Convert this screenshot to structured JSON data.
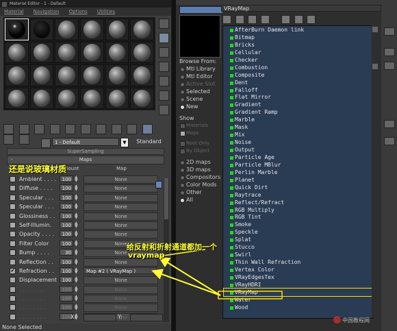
{
  "material_editor": {
    "title": "Material Editor - 1 - Default",
    "menu": [
      "Material",
      "Navigation",
      "Options",
      "Utilities"
    ],
    "material_name": "1 - Default",
    "material_type": "Standard",
    "rollout_supersampling": "SuperSampling",
    "rollout_maps_sign": "-",
    "rollout_maps": "Maps",
    "header_amount": "Amount",
    "header_map": "Map",
    "map_rows": [
      {
        "label": "Ambient . . . .",
        "amount": "100",
        "map": "None",
        "checked": false
      },
      {
        "label": "Diffuse . . . .",
        "amount": "100",
        "map": "None",
        "checked": false
      },
      {
        "label": "Specular . . .",
        "amount": "100",
        "map": "None",
        "checked": false
      },
      {
        "label": "Specular . . .",
        "amount": "100",
        "map": "None",
        "checked": false
      },
      {
        "label": "Glossiness . .",
        "amount": "100",
        "map": "None",
        "checked": false
      },
      {
        "label": "Self-Illumin.",
        "amount": "100",
        "map": "None",
        "checked": false
      },
      {
        "label": "Opacity . . . .",
        "amount": "100",
        "map": "None",
        "checked": false
      },
      {
        "label": "Filter Color",
        "amount": "100",
        "map": "None",
        "checked": false
      },
      {
        "label": "Bump . . . .",
        "amount": "30",
        "map": "None",
        "checked": false
      },
      {
        "label": "Reflection . .",
        "amount": "100",
        "map": "None",
        "checked": false
      },
      {
        "label": "Refraction . .",
        "amount": "100",
        "map": "Map #2   ( VRayMap )",
        "checked": true
      },
      {
        "label": "Displacement",
        "amount": "100",
        "map": "None",
        "checked": false
      },
      {
        "label": ". . . . . . . .",
        "amount": "100",
        "map": "None",
        "checked": false
      },
      {
        "label": ". . . . . . . .",
        "amount": "100",
        "map": "None",
        "checked": false
      },
      {
        "label": ". . . . . . . .",
        "amount": "100",
        "map": "None",
        "checked": false
      },
      {
        "label": ". . . . . . . .",
        "amount": "100",
        "map": "None",
        "checked": false
      }
    ],
    "status": "None Selected",
    "status_x": "X:",
    "status_y": "Y:"
  },
  "browser": {
    "title_field": "VRayMap",
    "browse_from_title": "Browse From:",
    "browse_from": [
      {
        "label": "Mtl Library",
        "on": false,
        "dim": false
      },
      {
        "label": "Mtl Editor",
        "on": false,
        "dim": false
      },
      {
        "label": "Active Slot",
        "on": false,
        "dim": true
      },
      {
        "label": "Selected",
        "on": false,
        "dim": false
      },
      {
        "label": "Scene",
        "on": false,
        "dim": false
      },
      {
        "label": "New",
        "on": true,
        "dim": false
      }
    ],
    "show_title": "Show",
    "show": [
      {
        "label": "Materials",
        "on": false
      },
      {
        "label": "Maps",
        "on": true
      }
    ],
    "show_extra": [
      {
        "label": "Root Only",
        "on": false
      },
      {
        "label": "By Object",
        "on": false
      }
    ],
    "map_type_filter": [
      {
        "label": "2D maps",
        "on": false
      },
      {
        "label": "3D maps",
        "on": false
      },
      {
        "label": "Compositors",
        "on": false
      },
      {
        "label": "Color Mods",
        "on": false
      },
      {
        "label": "Other",
        "on": false
      },
      {
        "label": "All",
        "on": true
      }
    ],
    "maps": [
      "AfterBurn Daemon link",
      "Bitmap",
      "Bricks",
      "Cellular",
      "Checker",
      "Combustion",
      "Composite",
      "Dent",
      "Falloff",
      "Flat Mirror",
      "Gradient",
      "Gradient Ramp",
      "Marble",
      "Mask",
      "Mix",
      "Noise",
      "Output",
      "Particle Age",
      "Particle MBlur",
      "Perlin Marble",
      "Planet",
      "Quick Dirt",
      "Raytrace",
      "Reflect/Refract",
      "RGB Multiply",
      "RGB Tint",
      "Smoke",
      "Speckle",
      "Splat",
      "Stucco",
      "Swirl",
      "Thin Wall Refraction",
      "Vertex Color",
      "VRayEdgesTex",
      "VRayHDRI",
      "VRayMap",
      "Water",
      "Wood"
    ],
    "highlighted_map": "VRayMap"
  },
  "annotations": {
    "note1": "还是说玻璃材质",
    "note2": "给反射和折射通道都加一个",
    "note3": "vraymap"
  },
  "watermark": "中国教程网",
  "colors": {
    "annotation": "#ffff33",
    "list_bg": "#2a3b54",
    "map_icon": "#2ecc40",
    "highlight": "#ffe000"
  }
}
